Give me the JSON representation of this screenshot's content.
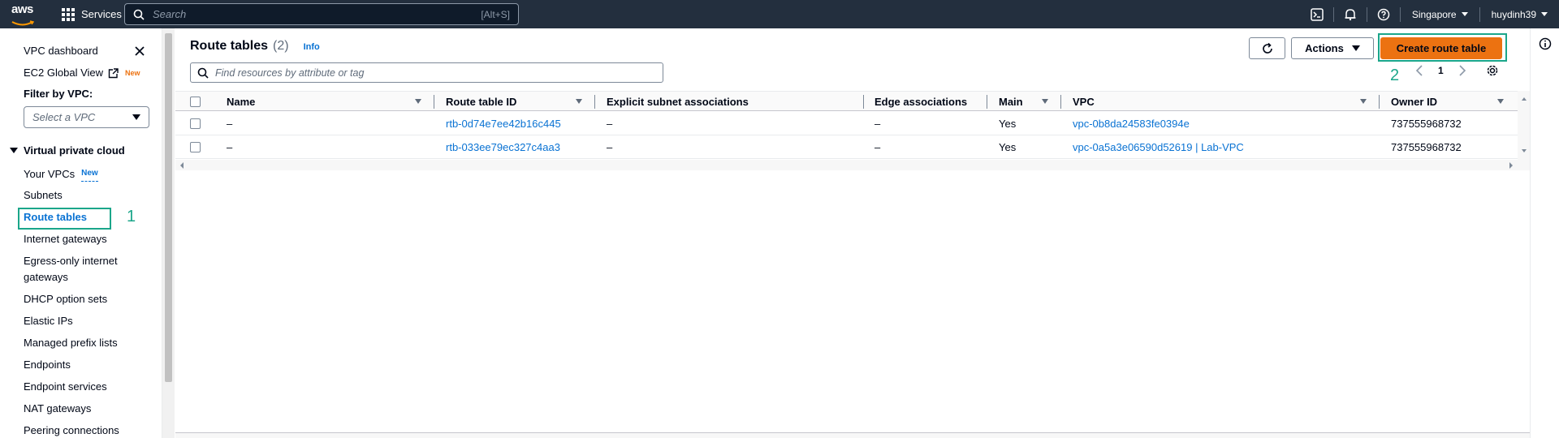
{
  "topnav": {
    "logo_text": "aws",
    "services_label": "Services",
    "search_placeholder": "Search",
    "search_shortcut": "[Alt+S]",
    "region": "Singapore",
    "user": "huydinh39"
  },
  "sidebar": {
    "vpc_dashboard": "VPC dashboard",
    "ec2_global_view": "EC2 Global View",
    "new_badge": "New",
    "filter_label": "Filter by VPC:",
    "select_placeholder": "Select a VPC",
    "section_title": "Virtual private cloud",
    "items": [
      {
        "label": "Your VPCs",
        "badge": "New"
      },
      {
        "label": "Subnets"
      },
      {
        "label": "Route tables"
      },
      {
        "label": "Internet gateways"
      },
      {
        "label": "Egress-only internet"
      },
      {
        "label": "gateways"
      },
      {
        "label": "DHCP option sets"
      },
      {
        "label": "Elastic IPs"
      },
      {
        "label": "Managed prefix lists"
      },
      {
        "label": "Endpoints"
      },
      {
        "label": "Endpoint services"
      },
      {
        "label": "NAT gateways"
      },
      {
        "label": "Peering connections"
      }
    ]
  },
  "annotations": {
    "one": "1",
    "two": "2"
  },
  "main": {
    "title": "Route tables",
    "count": "(2)",
    "info": "Info",
    "actions_label": "Actions",
    "create_label": "Create route table",
    "filter_placeholder": "Find resources by attribute or tag",
    "page_number": "1"
  },
  "table": {
    "columns": [
      "Name",
      "Route table ID",
      "Explicit subnet associations",
      "Edge associations",
      "Main",
      "VPC",
      "Owner ID"
    ],
    "rows": [
      [
        "–",
        "rtb-0d74e7ee42b16c445",
        "–",
        "–",
        "Yes",
        "vpc-0b8da24583fe0394e",
        "737555968732"
      ],
      [
        "–",
        "rtb-033ee79ec327c4aa3",
        "–",
        "–",
        "Yes",
        "vpc-0a5a3e06590d52619 | Lab-VPC",
        "737555968732"
      ]
    ]
  }
}
